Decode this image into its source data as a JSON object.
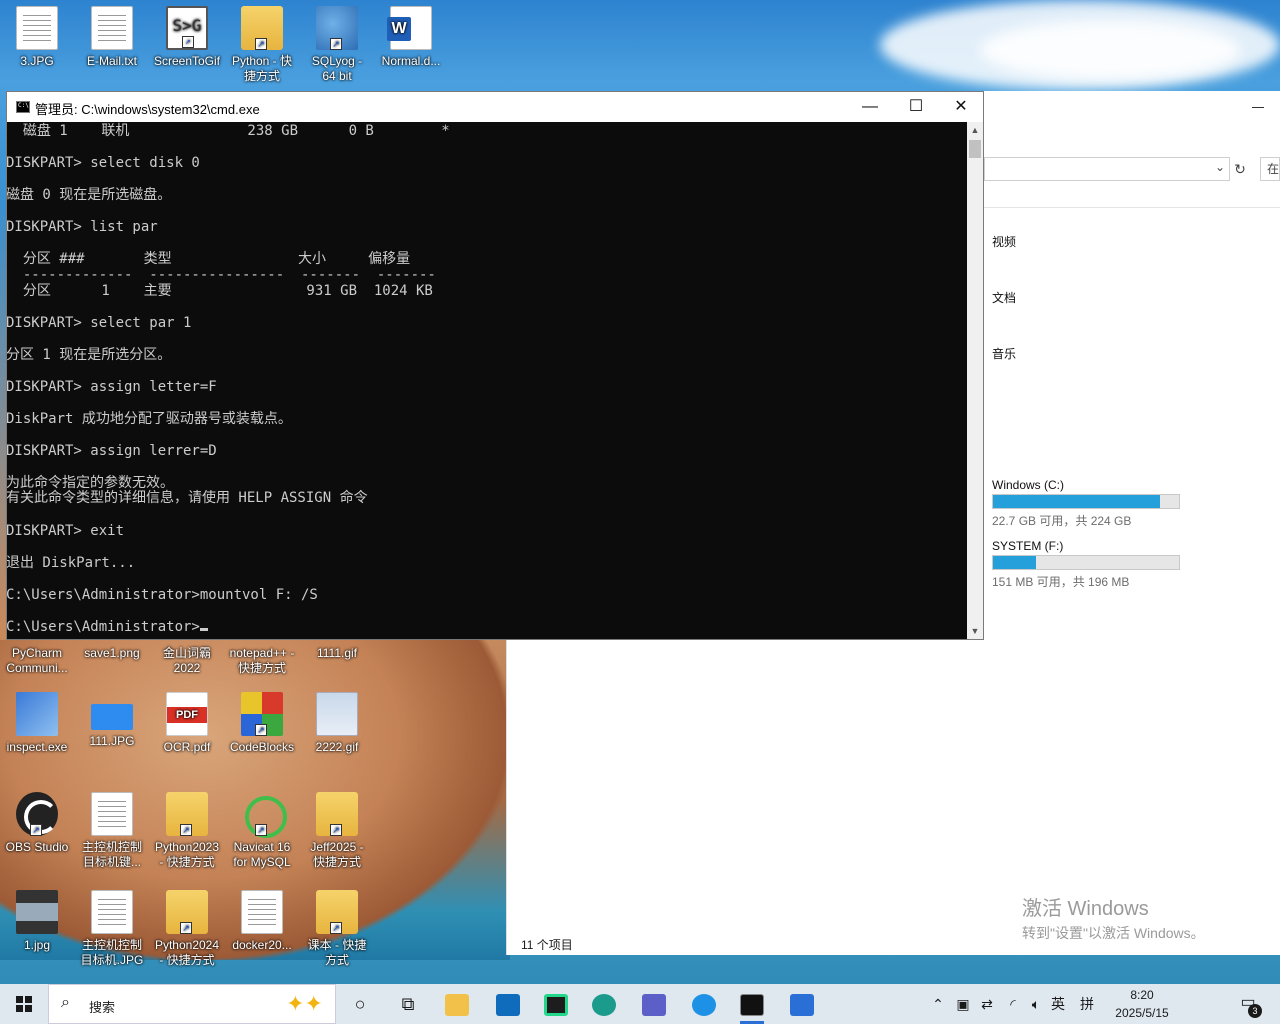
{
  "desktop": {
    "top_icons": [
      {
        "label": "3.JPG",
        "icon": "image-file-icon"
      },
      {
        "label": "E-Mail.txt",
        "icon": "text-file-icon"
      },
      {
        "label": "ScreenToGif",
        "icon": "screentogif-icon"
      },
      {
        "label": "Python - 快\n捷方式",
        "icon": "folder-shortcut-icon"
      },
      {
        "label": "SQLyog -\n64 bit",
        "icon": "sqlyog-icon"
      },
      {
        "label": "Normal.d...",
        "icon": "word-doc-icon"
      }
    ],
    "row1": [
      {
        "label": "PyCharm\nCommuni...",
        "icon": "pycharm-icon"
      },
      {
        "label": "save1.png",
        "icon": "image-file-icon"
      },
      {
        "label": "金山词霸\n2022",
        "icon": "kingsoft-icon"
      },
      {
        "label": "notepad++ -\n快捷方式",
        "icon": "notepadpp-icon"
      },
      {
        "label": "1111.gif",
        "icon": "gif-file-icon"
      }
    ],
    "row2": [
      {
        "label": "inspect.exe",
        "icon": "inspect-icon"
      },
      {
        "label": "111.JPG",
        "icon": "image-file-icon"
      },
      {
        "label": "OCR.pdf",
        "icon": "pdf-file-icon"
      },
      {
        "label": "CodeBlocks",
        "icon": "codeblocks-icon"
      },
      {
        "label": "2222.gif",
        "icon": "gif-file-icon"
      }
    ],
    "row3": [
      {
        "label": "OBS Studio",
        "icon": "obs-icon"
      },
      {
        "label": "主控机控制\n目标机键...",
        "icon": "document-file-icon"
      },
      {
        "label": "Python2023\n- 快捷方式",
        "icon": "folder-shortcut-icon"
      },
      {
        "label": "Navicat 16\nfor MySQL",
        "icon": "navicat-icon"
      },
      {
        "label": "Jeff2025 -\n快捷方式",
        "icon": "folder-shortcut-icon"
      }
    ],
    "row4": [
      {
        "label": "1.jpg",
        "icon": "image-file-icon"
      },
      {
        "label": "主控机控制\n目标机.JPG",
        "icon": "image-file-icon"
      },
      {
        "label": "Python2024\n- 快捷方式",
        "icon": "folder-shortcut-icon"
      },
      {
        "label": "docker20...",
        "icon": "text-file-icon"
      },
      {
        "label": "课本 - 快捷\n方式",
        "icon": "folder-shortcut-icon"
      }
    ]
  },
  "cmd": {
    "title": "管理员: C:\\windows\\system32\\cmd.exe",
    "minimize": "—",
    "maximize": "☐",
    "close": "✕",
    "lines": [
      "  磁盘 1    联机              238 GB      0 B        *",
      "DISKPART> select disk 0",
      "磁盘 0 现在是所选磁盘。",
      "DISKPART> list par",
      "  分区 ###       类型               大小     偏移量",
      "  -------------  ----------------  -------  -------",
      "  分区      1    主要                931 GB  1024 KB",
      "DISKPART> select par 1",
      "分区 1 现在是所选分区。",
      "DISKPART> assign letter=F",
      "DiskPart 成功地分配了驱动器号或装载点。",
      "DISKPART> assign lerrer=D",
      "为此命令指定的参数无效。",
      "有关此命令类型的详细信息，请使用 HELP ASSIGN 命令",
      "DISKPART> exit",
      "退出 DiskPart...",
      "C:\\Users\\Administrator>mountvol F: /S",
      "C:\\Users\\Administrator>"
    ]
  },
  "explorer": {
    "libraries": [
      "视频",
      "文档",
      "音乐"
    ],
    "search_placeholder": "在",
    "drives": [
      {
        "name": "Windows (C:)",
        "info": "22.7 GB 可用，共 224 GB",
        "used_fraction": 0.9
      },
      {
        "name": "SYSTEM (F:)",
        "info": "151 MB 可用，共 196 MB",
        "used_fraction": 0.23
      }
    ],
    "status": "11 个项目"
  },
  "activation": {
    "line1": "激活 Windows",
    "line2": "转到\"设置\"以激活 Windows。"
  },
  "taskbar": {
    "search_placeholder": "搜索",
    "ime_lang": "英",
    "ime_mode": "拼",
    "time": "8:20",
    "date": "2025/5/15",
    "notification_count": "3"
  },
  "colors": {
    "console_bg": "#0c0c0c",
    "console_text": "#cccccc",
    "drive_bar": "#26a0da",
    "taskbar_bg": "#dfe7ef"
  }
}
